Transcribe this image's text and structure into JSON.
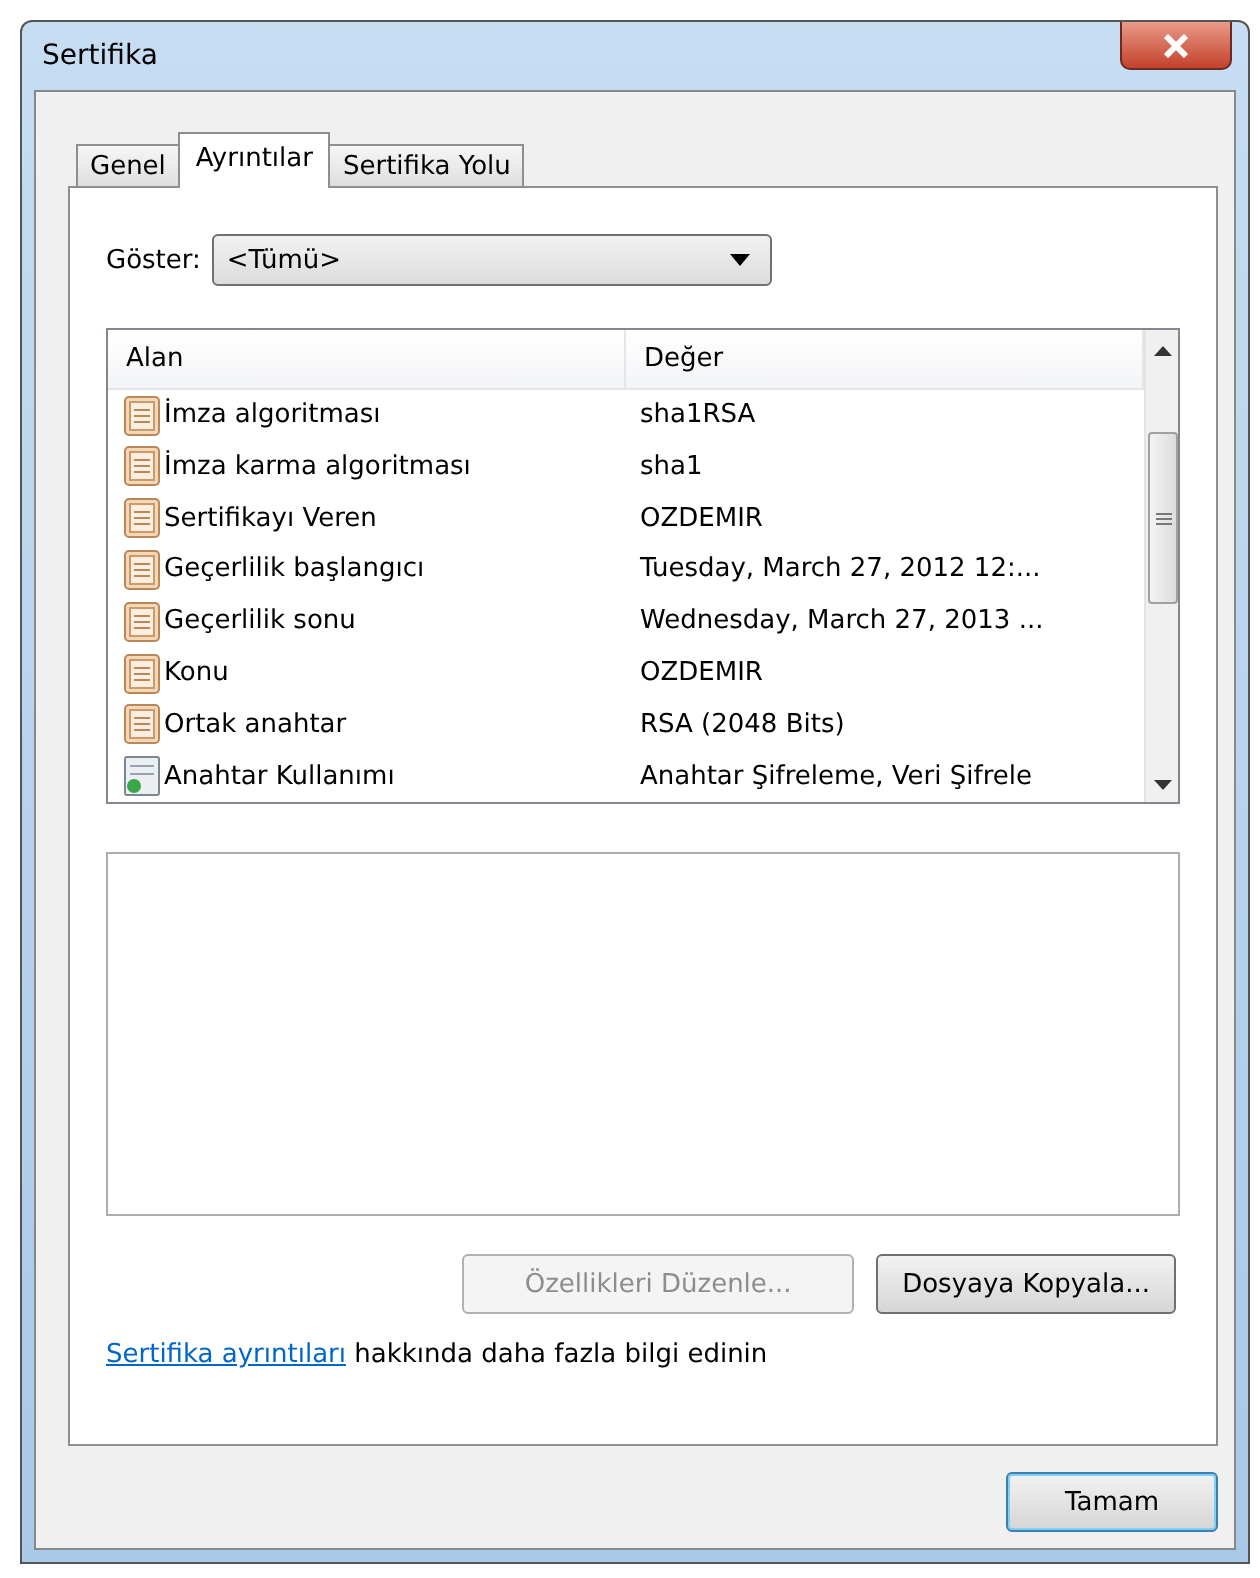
{
  "window": {
    "title": "Sertifika"
  },
  "tabs": [
    {
      "label": "Genel",
      "selected": false
    },
    {
      "label": "Ayrıntılar",
      "selected": true
    },
    {
      "label": "Sertifika Yolu",
      "selected": false
    }
  ],
  "show": {
    "label": "Göster:",
    "value": "<Tümü>"
  },
  "table": {
    "columns": [
      "Alan",
      "Değer"
    ],
    "rows": [
      {
        "kind": "field",
        "name": "İmza algoritması",
        "value": "sha1RSA"
      },
      {
        "kind": "field",
        "name": "İmza karma algoritması",
        "value": "sha1"
      },
      {
        "kind": "field",
        "name": "Sertifikayı Veren",
        "value": "OZDEMIR"
      },
      {
        "kind": "field",
        "name": "Geçerlilik başlangıcı",
        "value": "Tuesday, March 27, 2012 12:..."
      },
      {
        "kind": "field",
        "name": "Geçerlilik sonu",
        "value": "Wednesday, March 27, 2013 ..."
      },
      {
        "kind": "field",
        "name": "Konu",
        "value": "OZDEMIR"
      },
      {
        "kind": "field",
        "name": "Ortak anahtar",
        "value": "RSA (2048 Bits)"
      },
      {
        "kind": "extension",
        "name": "Anahtar Kullanımı",
        "value": "Anahtar Şifreleme, Veri Şifrele"
      }
    ]
  },
  "buttons": [
    {
      "label": "Özellikleri Düzenle...",
      "disabled": true
    },
    {
      "label": "Dosyaya Kopyala...",
      "disabled": false
    }
  ],
  "info": {
    "link": "Sertifika ayrıntıları",
    "text": "hakkında daha fazla bilgi edinin"
  },
  "ok_button": "Tamam"
}
